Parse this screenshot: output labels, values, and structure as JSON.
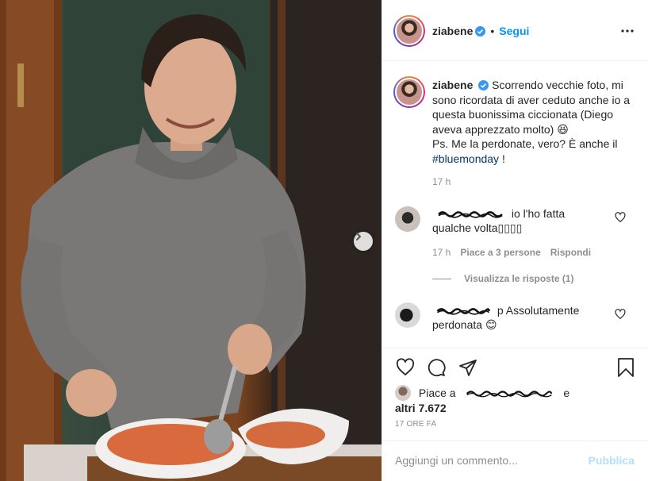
{
  "post": {
    "username": "ziabene",
    "verified": true,
    "follow_label": "Segui",
    "separator": "•",
    "icons": {
      "verified": "verified-badge-icon",
      "more": "more-options-icon",
      "next": "chevron-right-icon"
    }
  },
  "caption": {
    "username": "ziabene",
    "text_parts": [
      "Scorrendo vecchie foto, mi sono ricordata di aver ceduto anche io a questa buonissima ciccionata (Diego aveva apprezzato molto) 😆",
      "Ps. Me la perdonate, vero? È anche il"
    ],
    "hashtag": "#bluemonday",
    "end": " !",
    "time": "17 h"
  },
  "comments": [
    {
      "text_line1": "io l'ho fatta",
      "text_line2": "qualche volta▯▯▯▯",
      "time": "17 h",
      "likes": "Piace a 3 persone",
      "reply_label": "Rispondi",
      "view_replies": "Visualizza le risposte (1)"
    },
    {
      "text_line1": "p Assolutamente",
      "text_line2": "perdonata 😊"
    }
  ],
  "actions": {
    "icons": [
      "heart-icon",
      "comment-icon",
      "share-icon",
      "bookmark-icon"
    ],
    "likes_prefix": "Piace a",
    "likes_suffix": "e",
    "likes_count": "altri 7.672",
    "date": "17 ORE FA"
  },
  "add_comment": {
    "placeholder": "Aggiungi un commento...",
    "publish_label": "Pubblica"
  },
  "colors": {
    "accent": "#0095f6",
    "publish_disabled": "#b2dffc",
    "hashtag": "#00376b",
    "muted": "#8e8e8e",
    "text": "#262626"
  }
}
